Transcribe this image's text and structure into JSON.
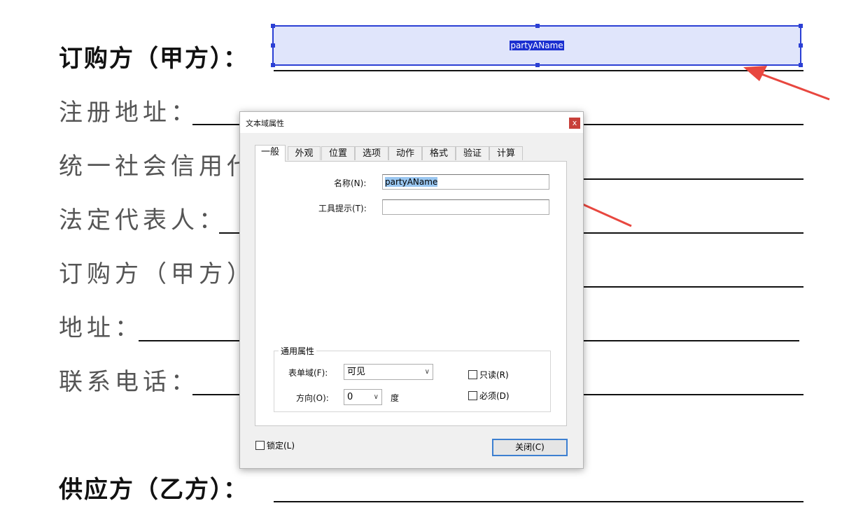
{
  "document": {
    "rows": [
      {
        "label": "订购方（甲方）："
      },
      {
        "label": "注册地址："
      },
      {
        "label": "统一社会信用代"
      },
      {
        "label": "法定代表人："
      },
      {
        "label": "订购方（甲方）"
      },
      {
        "label": "地址："
      },
      {
        "label": "联系电话："
      },
      {
        "label": "供应方（乙方）："
      }
    ],
    "selected_field_name": "partyAName"
  },
  "dialog": {
    "title": "文本域属性",
    "close_glyph": "x",
    "tabs": [
      "一般",
      "外观",
      "位置",
      "选项",
      "动作",
      "格式",
      "验证",
      "计算"
    ],
    "active_tab": "一般",
    "name_label": "名称(N):",
    "name_value": "partyAName",
    "tooltip_label": "工具提示(T):",
    "tooltip_value": "",
    "common_group": "通用属性",
    "form_field_label": "表单域(F):",
    "form_field_value": "可见",
    "orientation_label": "方向(O):",
    "orientation_value": "0",
    "degree_label": "度",
    "readonly_label": "只读(R)",
    "required_label": "必须(D)",
    "locked_label": "锁定(L)",
    "close_button": "关闭(C)"
  },
  "colors": {
    "annotation_arrow": "#e8473f",
    "field_highlight": "#e0e5fb",
    "field_border": "#2b3fd4"
  }
}
